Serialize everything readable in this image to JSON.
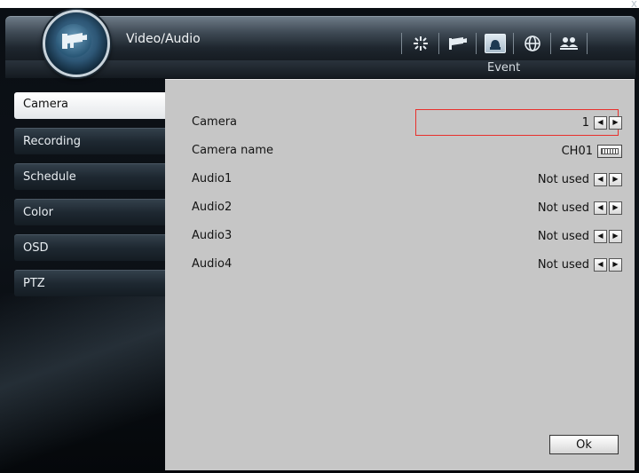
{
  "window": {
    "title": "Video/Audio",
    "close_glyph": "x"
  },
  "toolbar": {
    "icons": [
      "settings-sparkle-icon",
      "camera-icon",
      "event-alarm-icon",
      "network-globe-icon",
      "users-icon"
    ],
    "active_index": 2,
    "active_label": "Event"
  },
  "sidebar": {
    "items": [
      {
        "label": "Camera",
        "active": true
      },
      {
        "label": "Recording",
        "active": false
      },
      {
        "label": "Schedule",
        "active": false
      },
      {
        "label": "Color",
        "active": false
      },
      {
        "label": "OSD",
        "active": false
      },
      {
        "label": "PTZ",
        "active": false
      }
    ]
  },
  "settings": {
    "rows": [
      {
        "label": "Camera",
        "value": "1",
        "control": "arrows"
      },
      {
        "label": "Camera name",
        "value": "CH01",
        "control": "keyboard"
      },
      {
        "label": "Audio1",
        "value": "Not used",
        "control": "arrows"
      },
      {
        "label": "Audio2",
        "value": "Not used",
        "control": "arrows"
      },
      {
        "label": "Audio3",
        "value": "Not used",
        "control": "arrows"
      },
      {
        "label": "Audio4",
        "value": "Not used",
        "control": "arrows"
      }
    ],
    "ok_label": "Ok"
  },
  "colors": {
    "panel_bg": "#c6c6c6",
    "highlight": "#e8302c",
    "accent": "#2d5675"
  }
}
